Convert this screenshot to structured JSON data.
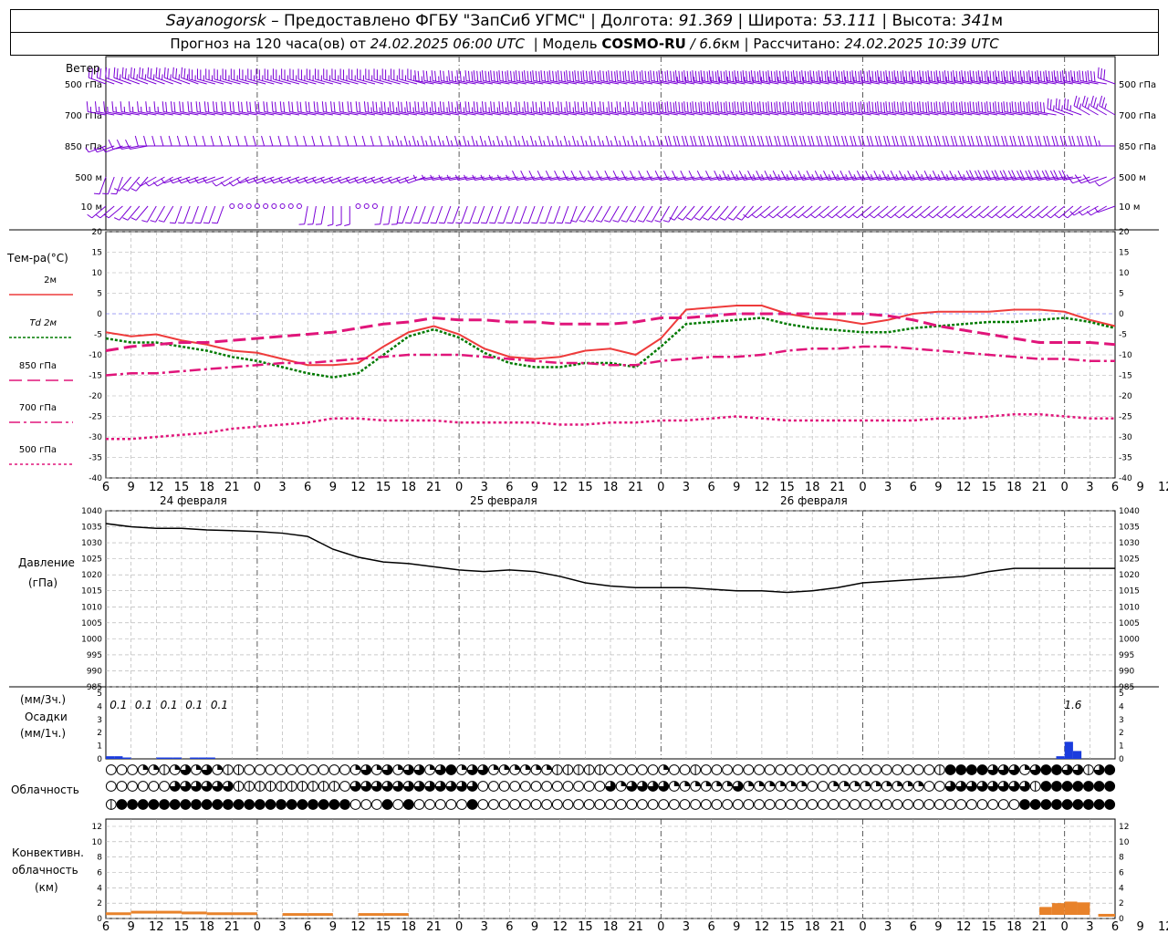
{
  "header": {
    "station": "Sayanogorsk",
    "provider": "– Предоставлено ФГБУ \"ЗапСиб УГМС\"",
    "lon_label": "Долгота:",
    "lon": "91.369",
    "lat_label": "Широта:",
    "lat": "53.111",
    "alt_label": "Высота:",
    "alt": "341",
    "alt_unit": "м",
    "forecast_label": "Прогноз на 120 часа(ов) от",
    "start": "24.02.2025 06:00 UTC",
    "model_label": "Модель",
    "model": "COSMO-RU",
    "resolution": "/ 6.6",
    "res_unit": "км",
    "calc_label": "Рассчитано:",
    "calc_time": "24.02.2025 10:39 UTC"
  },
  "labels": {
    "wind": "Ветер",
    "wind_levels": [
      "500 гПа",
      "700 гПа",
      "850 гПа",
      "500 м",
      "10 м"
    ],
    "temp_title": "Тем-ра(°С)",
    "temp_legend": [
      "2м",
      "Td 2м",
      "850 гПа",
      "700 гПа",
      "500 гПа"
    ],
    "pressure_title": "Давление",
    "pressure_unit": "(гПа)",
    "precip_unit3": "(мм/3ч.)",
    "precip_title": "Осадки",
    "precip_unit1": "(мм/1ч.)",
    "cloud_title": "Облачность",
    "conv_title1": "Конвективн.",
    "conv_title2": "облачность",
    "conv_title3": "(км)",
    "dates": [
      "24 февраля",
      "25 февраля",
      "26 февраля"
    ]
  },
  "colors": {
    "t2m": "#ee3b3b",
    "td2m": "#007a00",
    "upper": "#e0157a",
    "wind": "#7a00d6",
    "precip": "#1a3cdd",
    "conv": "#e8822a",
    "grid": "#aaaaaa"
  },
  "chart_data": [
    {
      "type": "line",
      "title": "Тем-ра(°С)",
      "x_hours": [
        0,
        3,
        6,
        9,
        12,
        15,
        18,
        21,
        24,
        27,
        30,
        33,
        36,
        39,
        42,
        45,
        48,
        51,
        54,
        57,
        60,
        63,
        66,
        69,
        72,
        75,
        78,
        81,
        84,
        87,
        90,
        93,
        96,
        99,
        102,
        105,
        108,
        111,
        114,
        117,
        120
      ],
      "x_tick_labels": [
        "6",
        "9",
        "12",
        "15",
        "18",
        "21",
        "0",
        "3",
        "6",
        "9",
        "12",
        "15",
        "18",
        "21",
        "0",
        "3",
        "6",
        "9",
        "12",
        "15",
        "18",
        "21",
        "0",
        "3",
        "6",
        "9",
        "12",
        "15",
        "18",
        "21",
        "0",
        "3",
        "6",
        "9",
        "12",
        "15",
        "18",
        "21",
        "0",
        "3",
        "6",
        "9",
        "12"
      ],
      "ylim": [
        -40,
        20
      ],
      "yticks": [
        20,
        15,
        10,
        5,
        0,
        -5,
        -10,
        -15,
        -20,
        -25,
        -30,
        -35,
        -40
      ],
      "series": [
        {
          "name": "2м",
          "values": [
            -4.5,
            -5.5,
            -5,
            -6.5,
            -7.5,
            -9,
            -9.5,
            -11,
            -12.5,
            -12.5,
            -12,
            -8,
            -4.5,
            -3,
            -5,
            -8.5,
            -10.5,
            -11,
            -10.5,
            -9,
            -8.5,
            -10,
            -6,
            1,
            1.5,
            2,
            2,
            0,
            -1,
            -1.5,
            -2.5,
            -1.5,
            0,
            0.5,
            0.5,
            0.5,
            1,
            1,
            0.5,
            -1.5,
            -3
          ]
        },
        {
          "name": "Td 2м",
          "values": [
            -6,
            -7,
            -7,
            -8,
            -9,
            -10.5,
            -11.5,
            -13,
            -14.5,
            -15.5,
            -14.5,
            -10,
            -5.5,
            -3.8,
            -5.8,
            -9.5,
            -12,
            -13,
            -13,
            -12,
            -12,
            -13,
            -8,
            -2.5,
            -2,
            -1.5,
            -1,
            -2.5,
            -3.5,
            -4,
            -4.5,
            -4.5,
            -3.5,
            -3,
            -2.5,
            -2,
            -2,
            -1.5,
            -1,
            -2,
            -3.5
          ]
        },
        {
          "name": "850 гПа",
          "values": [
            -9,
            -8,
            -7.5,
            -7,
            -7,
            -6.5,
            -6,
            -5.5,
            -5,
            -4.5,
            -3.5,
            -2.5,
            -2,
            -1,
            -1.5,
            -1.5,
            -2,
            -2,
            -2.5,
            -2.5,
            -2.5,
            -2,
            -1,
            -1,
            -0.5,
            0,
            0,
            0,
            0,
            0,
            0,
            -0.5,
            -1.5,
            -3,
            -4,
            -5,
            -6,
            -7,
            -7,
            -7,
            -7.5
          ]
        },
        {
          "name": "700 гПа",
          "values": [
            -15,
            -14.5,
            -14.5,
            -14,
            -13.5,
            -13,
            -12.5,
            -12,
            -12,
            -11.5,
            -11,
            -10.5,
            -10,
            -10,
            -10,
            -10.5,
            -11,
            -11.5,
            -12,
            -12,
            -12.5,
            -12.5,
            -11.5,
            -11,
            -10.5,
            -10.5,
            -10,
            -9,
            -8.5,
            -8.5,
            -8,
            -8,
            -8.5,
            -9,
            -9.5,
            -10,
            -10.5,
            -11,
            -11,
            -11.5,
            -11.5
          ]
        },
        {
          "name": "500 гПа",
          "values": [
            -30.5,
            -30.5,
            -30,
            -29.5,
            -29,
            -28,
            -27.5,
            -27,
            -26.5,
            -25.5,
            -25.5,
            -26,
            -26,
            -26,
            -26.5,
            -26.5,
            -26.5,
            -26.5,
            -27,
            -27,
            -26.5,
            -26.5,
            -26,
            -26,
            -25.5,
            -25,
            -25.5,
            -26,
            -26,
            -26,
            -26,
            -26,
            -26,
            -25.5,
            -25.5,
            -25,
            -24.5,
            -24.5,
            -25,
            -25.5,
            -25.5
          ]
        }
      ]
    },
    {
      "type": "line",
      "title": "Давление",
      "ylabel": "(гПа)",
      "ylim": [
        985,
        1040
      ],
      "yticks": [
        1040,
        1035,
        1030,
        1025,
        1020,
        1015,
        1010,
        1005,
        1000,
        995,
        990,
        985
      ],
      "series": [
        {
          "name": "Давление",
          "values": [
            1036,
            1035,
            1034.5,
            1034.5,
            1034,
            1033.8,
            1033.5,
            1033,
            1032,
            1028,
            1025.5,
            1024,
            1023.5,
            1022.5,
            1021.5,
            1021,
            1021.5,
            1021,
            1019.5,
            1017.5,
            1016.5,
            1016,
            1016,
            1016,
            1015.5,
            1015,
            1015,
            1014.5,
            1015,
            1016,
            1017.5,
            1018,
            1018.5,
            1019,
            1019.5,
            1021,
            1022,
            1022,
            1022,
            1022,
            1022
          ]
        }
      ]
    },
    {
      "type": "bar",
      "title": "Осадки",
      "ylabel": "(мм/1ч.)",
      "ylim": [
        0,
        5
      ],
      "yticks": [
        5,
        4,
        3,
        2,
        1,
        0
      ],
      "totals_3h": [
        {
          "hour": 1.5,
          "label": "0.1"
        },
        {
          "hour": 4.5,
          "label": "0.1"
        },
        {
          "hour": 7.5,
          "label": "0.1"
        },
        {
          "hour": 10.5,
          "label": "0.1"
        },
        {
          "hour": 13.5,
          "label": "0.1"
        },
        {
          "hour": 115,
          "label": "1.6"
        }
      ],
      "bars": [
        {
          "hour": 0,
          "value": 0.2
        },
        {
          "hour": 1,
          "value": 0.2
        },
        {
          "hour": 2,
          "value": 0.05
        },
        {
          "hour": 6,
          "value": 0.1
        },
        {
          "hour": 7,
          "value": 0.1
        },
        {
          "hour": 8,
          "value": 0.1
        },
        {
          "hour": 10,
          "value": 0.05
        },
        {
          "hour": 11,
          "value": 0.1
        },
        {
          "hour": 12,
          "value": 0.1
        },
        {
          "hour": 113,
          "value": 0.2
        },
        {
          "hour": 114,
          "value": 1.3
        },
        {
          "hour": 115,
          "value": 0.6
        }
      ]
    },
    {
      "type": "bar",
      "title": "Конвективн. облачность",
      "ylabel": "(км)",
      "ylim": [
        0,
        14
      ],
      "yticks": [
        12,
        10,
        8,
        6,
        4,
        2,
        0
      ],
      "bars": [
        {
          "from": 0,
          "to": 3,
          "value": 0.8
        },
        {
          "from": 3,
          "to": 9,
          "value": 1.0
        },
        {
          "from": 9,
          "to": 12,
          "value": 0.9
        },
        {
          "from": 12,
          "to": 18,
          "value": 0.8
        },
        {
          "from": 21,
          "to": 24,
          "value": 0.7
        },
        {
          "from": 24,
          "to": 27,
          "value": 0.7
        },
        {
          "from": 30,
          "to": 33,
          "value": 0.7
        },
        {
          "from": 33,
          "to": 36,
          "value": 0.7
        },
        {
          "from": 111,
          "to": 112.5,
          "value": 1.5
        },
        {
          "from": 112.5,
          "to": 114,
          "value": 2.0
        },
        {
          "from": 114,
          "to": 115.5,
          "value": 2.2
        },
        {
          "from": 115.5,
          "to": 117,
          "value": 2.1
        },
        {
          "from": 118,
          "to": 120,
          "value": 0.6
        }
      ]
    }
  ],
  "wind_barbs": {
    "levels": [
      {
        "name": "500 гПа",
        "speeds": [
          20,
          25,
          25,
          25,
          25,
          25,
          25,
          25,
          25,
          25,
          25,
          25,
          25,
          25,
          25,
          30,
          30,
          30,
          30,
          30,
          30,
          30,
          30,
          35,
          35,
          35,
          35,
          35,
          35,
          35,
          35,
          35,
          35,
          35,
          35,
          35,
          35,
          35,
          35,
          30,
          30
        ],
        "dirs": [
          290,
          290,
          290,
          290,
          285,
          285,
          285,
          285,
          285,
          285,
          285,
          285,
          285,
          280,
          280,
          280,
          280,
          280,
          280,
          280,
          280,
          280,
          280,
          280,
          280,
          280,
          280,
          280,
          280,
          280,
          280,
          280,
          280,
          280,
          280,
          280,
          280,
          280,
          280,
          280,
          290
        ]
      },
      {
        "name": "700 гПа",
        "speeds": [
          15,
          15,
          15,
          20,
          20,
          20,
          20,
          20,
          20,
          20,
          20,
          25,
          25,
          25,
          25,
          25,
          25,
          25,
          25,
          25,
          25,
          25,
          30,
          30,
          30,
          30,
          30,
          30,
          30,
          30,
          30,
          30,
          30,
          30,
          30,
          30,
          30,
          30,
          25,
          25,
          25
        ],
        "dirs": [
          280,
          280,
          280,
          280,
          280,
          280,
          280,
          280,
          280,
          280,
          280,
          280,
          280,
          280,
          280,
          280,
          280,
          280,
          280,
          280,
          280,
          280,
          280,
          280,
          280,
          280,
          280,
          280,
          280,
          280,
          280,
          280,
          280,
          280,
          280,
          280,
          280,
          280,
          290,
          300,
          300
        ]
      },
      {
        "name": "850 гПа",
        "speeds": [
          5,
          10,
          10,
          10,
          10,
          10,
          10,
          10,
          10,
          10,
          10,
          10,
          15,
          15,
          15,
          15,
          15,
          15,
          15,
          15,
          15,
          15,
          15,
          20,
          20,
          20,
          20,
          20,
          20,
          20,
          20,
          20,
          20,
          20,
          20,
          20,
          20,
          20,
          20,
          20,
          15
        ],
        "dirs": [
          250,
          260,
          270,
          270,
          270,
          270,
          270,
          270,
          270,
          270,
          270,
          270,
          270,
          270,
          270,
          270,
          270,
          270,
          270,
          270,
          270,
          270,
          270,
          270,
          270,
          270,
          270,
          270,
          270,
          270,
          270,
          270,
          270,
          270,
          270,
          270,
          270,
          270,
          270,
          270,
          270
        ]
      },
      {
        "name": "500 м",
        "speeds": [
          5,
          5,
          5,
          5,
          5,
          5,
          5,
          5,
          5,
          5,
          5,
          5,
          5,
          5,
          5,
          5,
          5,
          10,
          10,
          10,
          10,
          10,
          10,
          10,
          10,
          15,
          15,
          15,
          15,
          15,
          15,
          15,
          15,
          15,
          15,
          20,
          20,
          20,
          20,
          10,
          5
        ],
        "dirs": [
          200,
          220,
          240,
          250,
          250,
          240,
          250,
          250,
          250,
          250,
          250,
          250,
          250,
          260,
          260,
          260,
          260,
          260,
          260,
          260,
          260,
          260,
          260,
          260,
          260,
          260,
          260,
          260,
          260,
          260,
          260,
          260,
          260,
          260,
          260,
          260,
          260,
          260,
          260,
          250,
          240
        ]
      },
      {
        "name": "10 м",
        "speeds": [
          3,
          3,
          5,
          5,
          3,
          0,
          0,
          0,
          3,
          3,
          0,
          3,
          5,
          5,
          5,
          5,
          5,
          5,
          5,
          5,
          5,
          5,
          5,
          5,
          5,
          5,
          5,
          5,
          5,
          5,
          5,
          5,
          5,
          5,
          5,
          5,
          5,
          5,
          5,
          5,
          5
        ],
        "dirs": [
          230,
          220,
          210,
          200,
          200,
          0,
          0,
          0,
          190,
          180,
          0,
          190,
          200,
          200,
          200,
          200,
          200,
          200,
          200,
          210,
          210,
          210,
          210,
          220,
          220,
          220,
          230,
          230,
          230,
          230,
          230,
          230,
          230,
          230,
          230,
          230,
          230,
          230,
          230,
          240,
          250
        ]
      }
    ]
  },
  "cloud_rows": {
    "upper": [
      0,
      0,
      0,
      2,
      2,
      1,
      2,
      3,
      2,
      3,
      2,
      1,
      1,
      0,
      0,
      0,
      0,
      0,
      0,
      0,
      0,
      0,
      0,
      2,
      3,
      2,
      3,
      2,
      3,
      3,
      2,
      3,
      4,
      2,
      3,
      3,
      2,
      2,
      2,
      2,
      2,
      2,
      1,
      1,
      1,
      1,
      1,
      0,
      0,
      0,
      0,
      0,
      2,
      0,
      0,
      1,
      0,
      0,
      0,
      0,
      0,
      0,
      0,
      0,
      0,
      0,
      0,
      0,
      0,
      0,
      0,
      0,
      0,
      0,
      0,
      0,
      0,
      0,
      1,
      4,
      4,
      4,
      4,
      3,
      3,
      3,
      2,
      3,
      4,
      4,
      3,
      3,
      1,
      3,
      4
    ],
    "middle": [
      0,
      0,
      0,
      0,
      0,
      0,
      3,
      3,
      3,
      3,
      3,
      3,
      1,
      1,
      1,
      1,
      1,
      1,
      1,
      1,
      1,
      1,
      0,
      3,
      3,
      3,
      3,
      3,
      3,
      3,
      3,
      3,
      3,
      3,
      3,
      0,
      0,
      0,
      0,
      0,
      0,
      0,
      0,
      0,
      0,
      0,
      0,
      3,
      2,
      3,
      3,
      3,
      3,
      2,
      2,
      2,
      2,
      2,
      2,
      3,
      2,
      2,
      2,
      2,
      2,
      2,
      0,
      0,
      2,
      2,
      2,
      2,
      2,
      2,
      2,
      2,
      2,
      0,
      0,
      3,
      3,
      3,
      3,
      3,
      3,
      3,
      3,
      1,
      4,
      4,
      4,
      4,
      4,
      4,
      4
    ],
    "lower": [
      1,
      4,
      4,
      4,
      4,
      4,
      4,
      4,
      4,
      4,
      4,
      4,
      4,
      4,
      4,
      4,
      4,
      4,
      4,
      4,
      4,
      4,
      4,
      0,
      0,
      0,
      4,
      0,
      4,
      0,
      0,
      0,
      0,
      0,
      4,
      0,
      0,
      0,
      0,
      0,
      0,
      0,
      0,
      0,
      0,
      0,
      0,
      0,
      0,
      0,
      0,
      0,
      0,
      0,
      0,
      0,
      0,
      0,
      0,
      0,
      0,
      0,
      0,
      0,
      0,
      0,
      0,
      0,
      0,
      0,
      0,
      0,
      0,
      0,
      0,
      0,
      0,
      0,
      0,
      0,
      0,
      0,
      0,
      0,
      0,
      0,
      4,
      4,
      4,
      4,
      4,
      4,
      4,
      4,
      4
    ]
  }
}
